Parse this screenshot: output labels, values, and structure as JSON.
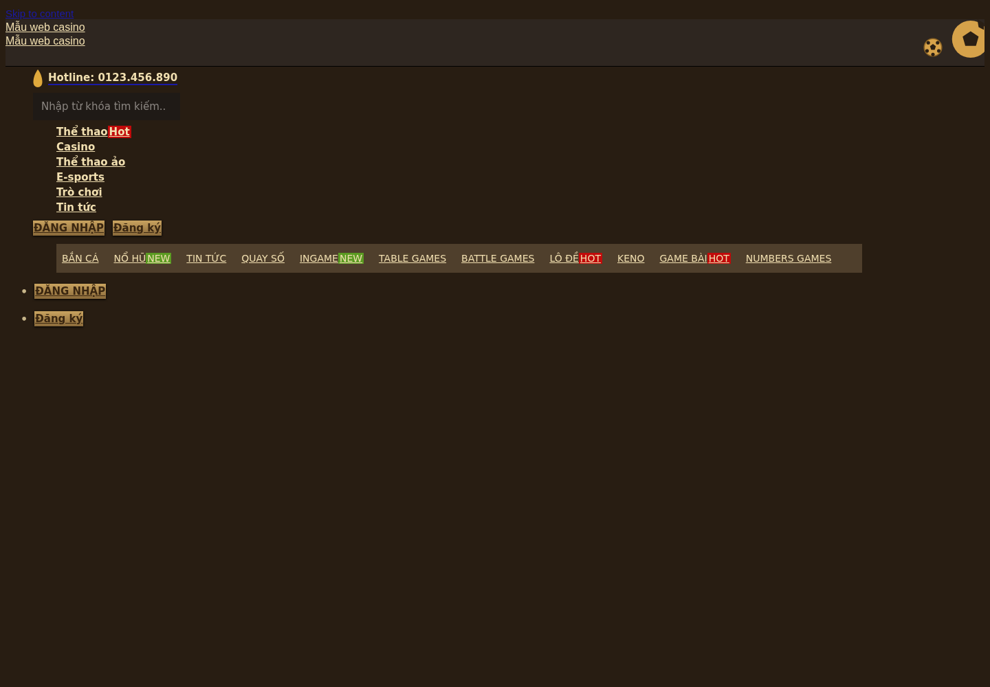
{
  "skip_link": "Skip to content",
  "logos": [
    "Mẫu web casino",
    "Mẫu web casino"
  ],
  "hotline": "Hotline: 0123.456.890",
  "search": {
    "placeholder": "Nhập từ khóa tìm kiếm.."
  },
  "side_menu": [
    {
      "label": "Thể thao",
      "badge": {
        "text": "Hot",
        "kind": "hot"
      }
    },
    {
      "label": "Casino"
    },
    {
      "label": "Thể thao ảo"
    },
    {
      "label": "E-sports"
    },
    {
      "label": "Trò chơi"
    },
    {
      "label": "Tin tức"
    }
  ],
  "header_buttons": [
    {
      "label": "ĐĂNG NHẬP"
    },
    {
      "label": "Đăng ký"
    }
  ],
  "main_menu": [
    {
      "label": "BẮN CÁ"
    },
    {
      "label": "NỔ HŨ",
      "badge": {
        "text": "NEW",
        "kind": "new"
      }
    },
    {
      "label": "TIN TỨC"
    },
    {
      "label": "QUAY SỐ"
    },
    {
      "label": "INGAME",
      "badge": {
        "text": "NEW",
        "kind": "new"
      }
    },
    {
      "label": "TABLE GAMES"
    },
    {
      "label": "BATTLE GAMES"
    },
    {
      "label": "LÔ ĐỀ",
      "badge": {
        "text": "HOT",
        "kind": "hot"
      }
    },
    {
      "label": "KENO"
    },
    {
      "label": "GAME BÀI",
      "badge": {
        "text": "HOT",
        "kind": "hot"
      }
    },
    {
      "label": "NUMBERS GAMES"
    }
  ],
  "footer_buttons": [
    {
      "marker": "•",
      "label": "ĐĂNG NHẬP"
    },
    {
      "marker": "•",
      "label": "Đăng ký"
    }
  ]
}
